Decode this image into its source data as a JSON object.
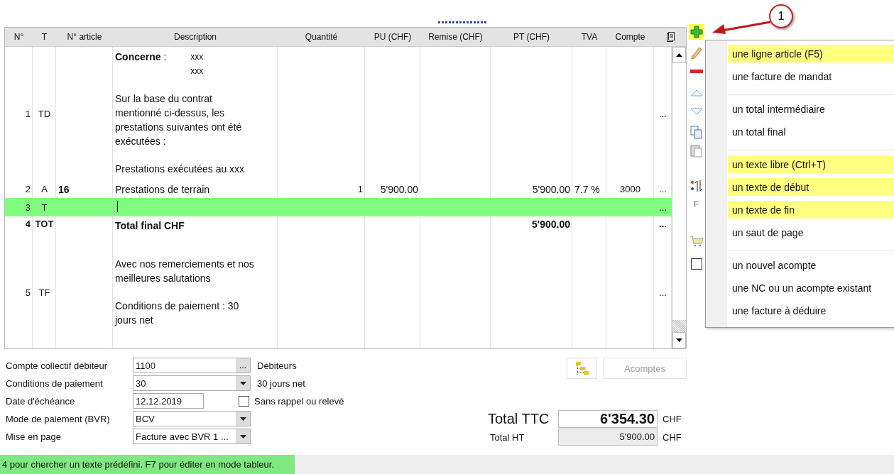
{
  "table": {
    "columns": [
      "N°",
      "T",
      "N° article",
      "Description",
      "Quantité",
      "PU (CHF)",
      "Remise (CHF)",
      "PT (CHF)",
      "TVA",
      "Compte"
    ],
    "rows": [
      {
        "kind": "text",
        "no": "1",
        "type": "TD",
        "selected": false,
        "description": [
          {
            "kind": "subject",
            "label": "Concerne",
            "colon": " :",
            "values": [
              "xxx",
              "xxx"
            ]
          },
          {
            "kind": "para",
            "text": "Sur la base du contrat\nmentionné ci-dessus, les\nprestations suivantes ont été\nexécutées :"
          },
          {
            "kind": "para",
            "text": "Prestations exécutées au xxx"
          }
        ],
        "more": "..."
      },
      {
        "kind": "article",
        "no": "2",
        "type": "A",
        "article": "16",
        "selected": false,
        "description": [
          {
            "kind": "para",
            "text": "Prestations de terrain"
          }
        ],
        "quantity": "1",
        "unit_price": "5'900.00",
        "total": "5'900.00",
        "vat": "7.7 %",
        "account": "3000",
        "more": "..."
      },
      {
        "kind": "text",
        "no": "3",
        "type": "T",
        "selected": true,
        "description": [],
        "more": "..."
      },
      {
        "kind": "total",
        "no": "4",
        "type": "TOT",
        "selected": false,
        "description": [
          {
            "kind": "para",
            "text": "Total final CHF"
          }
        ],
        "total": "5'900.00",
        "more": "..."
      },
      {
        "kind": "text",
        "no": "5",
        "type": "TF",
        "selected": false,
        "description": [
          {
            "kind": "para",
            "text": "Avec nos remerciements et nos\nmeilleures salutations"
          },
          {
            "kind": "para",
            "text": "Conditions de paiement : 30\njours net"
          }
        ],
        "more": "..."
      }
    ]
  },
  "toolbar": [
    {
      "kind": "add",
      "highlighted": true
    },
    {
      "kind": "edit",
      "highlighted": false
    },
    {
      "kind": "delete",
      "highlighted": false
    },
    {
      "kind": "up",
      "highlighted": false
    },
    {
      "kind": "down",
      "highlighted": false
    },
    {
      "kind": "copy",
      "highlighted": false
    },
    {
      "kind": "paste",
      "highlighted": false
    },
    {
      "kind": "sort",
      "highlighted": false
    },
    {
      "kind": "letter",
      "label": "F",
      "highlighted": false
    },
    {
      "kind": "cart",
      "highlighted": false
    },
    {
      "kind": "box",
      "highlighted": false
    }
  ],
  "callout": {
    "label": "1"
  },
  "menu": {
    "groups": [
      [
        {
          "label": "une ligne article (F5)",
          "highlighted": true
        },
        {
          "label": "une facture de mandat",
          "highlighted": false
        }
      ],
      [
        {
          "label": "un total intermédiaire",
          "highlighted": false
        },
        {
          "label": "un total final",
          "highlighted": false
        }
      ],
      [
        {
          "label": "un texte libre (Ctrl+T)",
          "highlighted": true
        },
        {
          "label": "un texte de début",
          "highlighted": true
        },
        {
          "label": "un texte de fin",
          "highlighted": true
        },
        {
          "label": "un saut de page",
          "highlighted": false
        }
      ],
      [
        {
          "label": "un nouvel acompte",
          "highlighted": false
        },
        {
          "label": "une NC ou un acompte existant",
          "highlighted": false
        },
        {
          "label": "une facture à déduire",
          "highlighted": false
        }
      ]
    ]
  },
  "form": [
    {
      "label": "Compte collectif débiteur",
      "kind": "lookup",
      "value": "1100",
      "button": "...",
      "aside": "Débiteurs"
    },
    {
      "label": "Conditions de paiement",
      "kind": "dropdown",
      "value": "30",
      "aside": "30 jours net"
    },
    {
      "label": "Date d'échéance",
      "kind": "date",
      "value": "12.12.2019",
      "checkbox": {
        "label": "Sans rappel ou relevé",
        "checked": false
      }
    },
    {
      "label": "Mode de paiement (BVR)",
      "kind": "dropdown",
      "value": "BCV"
    },
    {
      "label": "Mise en page",
      "kind": "dropdown",
      "value": "Facture avec BVR 1 ..."
    }
  ],
  "actions": {
    "acomptes": {
      "label": "Acomptes",
      "disabled": true
    }
  },
  "totals": {
    "ttc": {
      "label": "Total TTC",
      "value": "6'354.30",
      "currency": "CHF"
    },
    "ht": {
      "label": "Total HT",
      "value": "5'900.00",
      "currency": "CHF"
    }
  },
  "status_bar": {
    "text": "4 pour chercher un texte prédéfini. F7 pour éditer en mode tableur."
  }
}
